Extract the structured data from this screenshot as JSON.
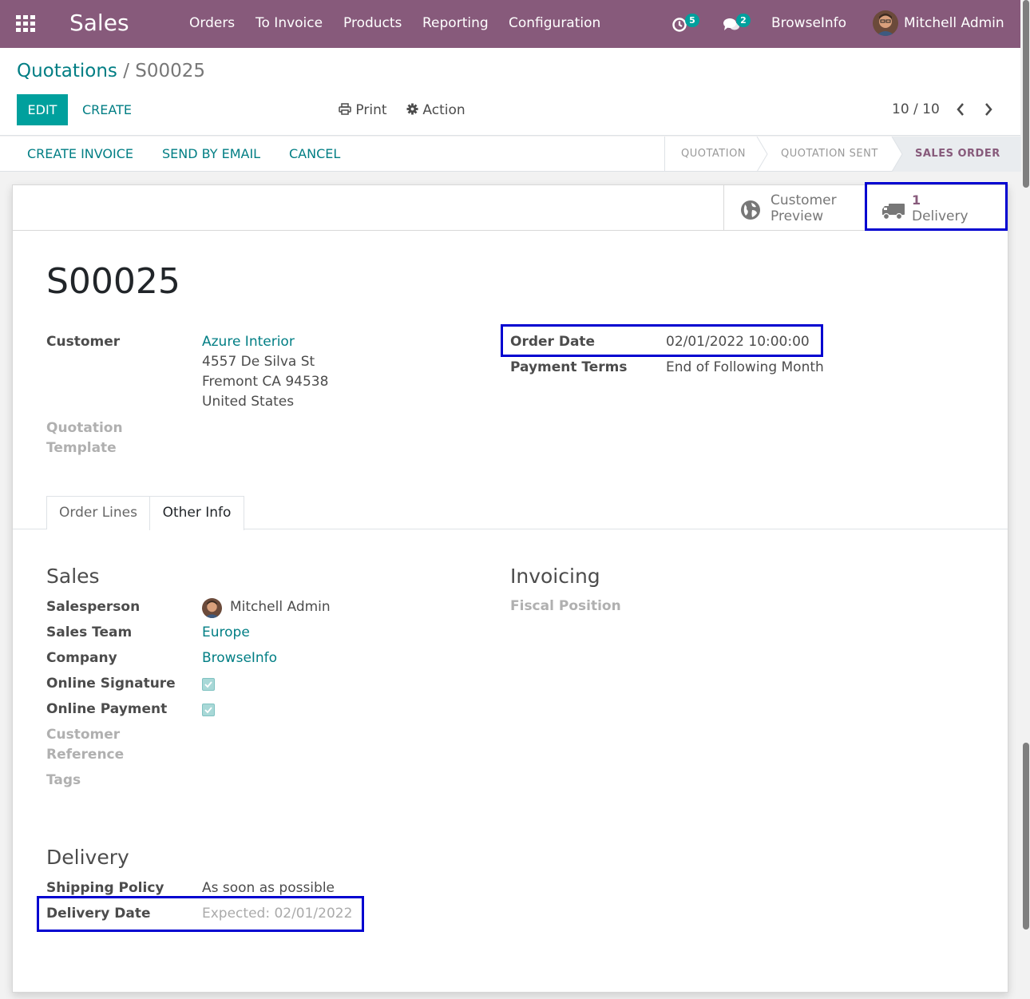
{
  "navbar": {
    "app_name": "Sales",
    "menu": [
      "Orders",
      "To Invoice",
      "Products",
      "Reporting",
      "Configuration"
    ],
    "activity_count": "5",
    "message_count": "2",
    "company": "BrowseInfo",
    "user": "Mitchell Admin",
    "color": "#875a7b"
  },
  "breadcrumb": {
    "parent": "Quotations",
    "separator": "/",
    "current": "S00025"
  },
  "control": {
    "edit_label": "EDIT",
    "create_label": "CREATE",
    "print_label": "Print",
    "action_label": "Action",
    "pager": "10 / 10"
  },
  "statusbar": {
    "buttons": [
      "CREATE INVOICE",
      "SEND BY EMAIL",
      "CANCEL"
    ],
    "stages": [
      "QUOTATION",
      "QUOTATION SENT",
      "SALES ORDER"
    ],
    "active_stage": "SALES ORDER"
  },
  "smart_buttons": {
    "customer_preview": {
      "line1": "Customer",
      "line2": "Preview",
      "icon": "globe-icon"
    },
    "delivery": {
      "count": "1",
      "label": "Delivery",
      "icon": "truck-icon"
    }
  },
  "record": {
    "name": "S00025",
    "customer_label": "Customer",
    "customer_name": "Azure Interior",
    "address": [
      "4557 De Silva St",
      "Fremont CA 94538",
      "United States"
    ],
    "quotation_template_label": [
      "Quotation",
      "Template"
    ],
    "order_date_label": "Order Date",
    "order_date": "02/01/2022 10:00:00",
    "payment_terms_label": "Payment Terms",
    "payment_terms": "End of Following Month"
  },
  "tabs": [
    "Order Lines",
    "Other Info"
  ],
  "active_tab": "Other Info",
  "sales_section": {
    "title": "Sales",
    "salesperson_label": "Salesperson",
    "salesperson": "Mitchell Admin",
    "sales_team_label": "Sales Team",
    "sales_team": "Europe",
    "company_label": "Company",
    "company": "BrowseInfo",
    "online_signature_label": "Online Signature",
    "online_signature": true,
    "online_payment_label": "Online Payment",
    "online_payment": true,
    "customer_reference_label": [
      "Customer",
      "Reference"
    ],
    "tags_label": "Tags"
  },
  "invoicing_section": {
    "title": "Invoicing",
    "fiscal_position_label": "Fiscal Position"
  },
  "delivery_section": {
    "title": "Delivery",
    "shipping_policy_label": "Shipping Policy",
    "shipping_policy": "As soon as possible",
    "delivery_date_label": "Delivery Date",
    "delivery_date": "Expected: 02/01/2022"
  },
  "colors": {
    "primary": "#875a7b",
    "accent": "#00a09d",
    "link": "#017e84",
    "highlight": "#0000d0"
  }
}
